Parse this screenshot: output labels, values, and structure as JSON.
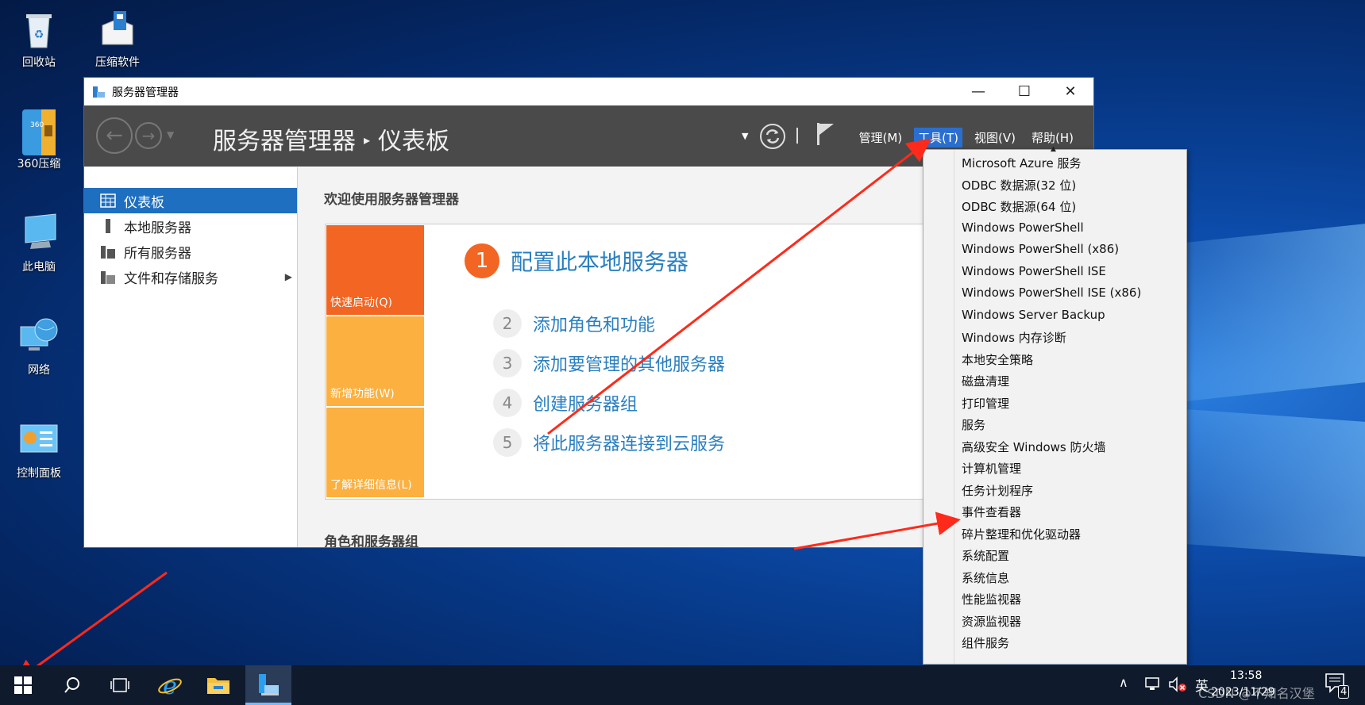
{
  "desktop": {
    "icons": [
      {
        "label": "回收站",
        "icon": "recycle-bin-icon"
      },
      {
        "label": "压缩软件",
        "icon": "package-icon"
      },
      {
        "label": "360压缩",
        "icon": "zip-archive-icon"
      },
      {
        "label": "此电脑",
        "icon": "computer-icon"
      },
      {
        "label": "网络",
        "icon": "network-globe-icon"
      },
      {
        "label": "控制面板",
        "icon": "control-panel-icon"
      }
    ]
  },
  "window": {
    "title": "服务器管理器",
    "controls": {
      "minimize": "—",
      "maximize": "☐",
      "close": "✕"
    }
  },
  "header": {
    "breadcrumb_app": "服务器管理器",
    "breadcrumb_sep": "▸",
    "breadcrumb_page": "仪表板",
    "menus": [
      "管理(M)",
      "工具(T)",
      "视图(V)",
      "帮助(H)"
    ]
  },
  "sidebar": {
    "items": [
      {
        "label": "仪表板",
        "selected": true
      },
      {
        "label": "本地服务器"
      },
      {
        "label": "所有服务器"
      },
      {
        "label": "文件和存储服务",
        "expander": "▶"
      }
    ]
  },
  "main": {
    "welcome_title": "欢迎使用服务器管理器",
    "tiles": [
      "快速启动(Q)",
      "新增功能(W)",
      "了解详细信息(L)"
    ],
    "steps": [
      {
        "num": "1",
        "label": "配置此本地服务器"
      },
      {
        "num": "2",
        "label": "添加角色和功能"
      },
      {
        "num": "3",
        "label": "添加要管理的其他服务器"
      },
      {
        "num": "4",
        "label": "创建服务器组"
      },
      {
        "num": "5",
        "label": "将此服务器连接到云服务"
      }
    ],
    "roles_title": "角色和服务器组"
  },
  "tools_menu": {
    "scroll_up": "▲",
    "items": [
      "Microsoft Azure 服务",
      "ODBC 数据源(32 位)",
      "ODBC 数据源(64 位)",
      "Windows PowerShell",
      "Windows PowerShell (x86)",
      "Windows PowerShell ISE",
      "Windows PowerShell ISE (x86)",
      "Windows Server Backup",
      "Windows 内存诊断",
      "本地安全策略",
      "磁盘清理",
      "打印管理",
      "服务",
      "高级安全 Windows 防火墙",
      "计算机管理",
      "任务计划程序",
      "事件查看器",
      "碎片整理和优化驱动器",
      "系统配置",
      "系统信息",
      "性能监视器",
      "资源监视器",
      "组件服务"
    ]
  },
  "taskbar": {
    "tray": {
      "ime": "英",
      "time": "13:58",
      "date": "2023/11/29",
      "notification_count": "4",
      "watermark": "CSDN @不知名汉堡"
    }
  },
  "colors": {
    "accent": "#1e6fc0",
    "quick_start": "#f26522",
    "tile_yellow": "#fbb040",
    "link": "#2a7fc0",
    "annotation_arrow": "#ff2a1a"
  }
}
